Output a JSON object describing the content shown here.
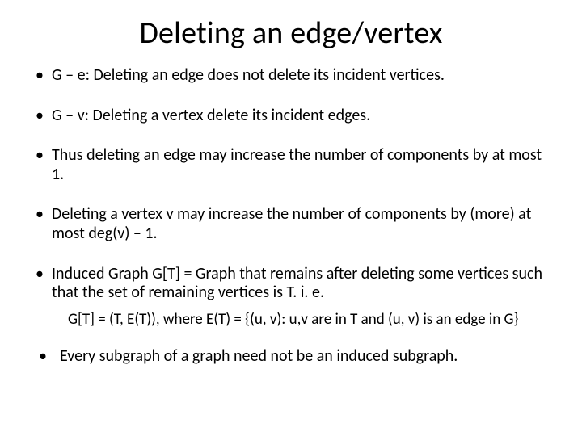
{
  "title": "Deleting an edge/vertex",
  "bullets": [
    "G – e: Deleting an edge does not delete its incident vertices.",
    "G – v: Deleting a vertex delete its incident edges.",
    "Thus deleting an edge may increase the number of components by at most 1.",
    "Deleting a vertex v may increase the number of components by (more) at most deg(v) – 1.",
    "Induced Graph G[T] = Graph that remains after deleting some vertices such that the set of remaining vertices is T. i. e."
  ],
  "formula": "G[T] = (T, E(T)), where E(T) = {(u, v): u,v are in T and  (u, v) is an edge in G}",
  "last_bullet": "Every subgraph of a graph need not be an induced subgraph."
}
